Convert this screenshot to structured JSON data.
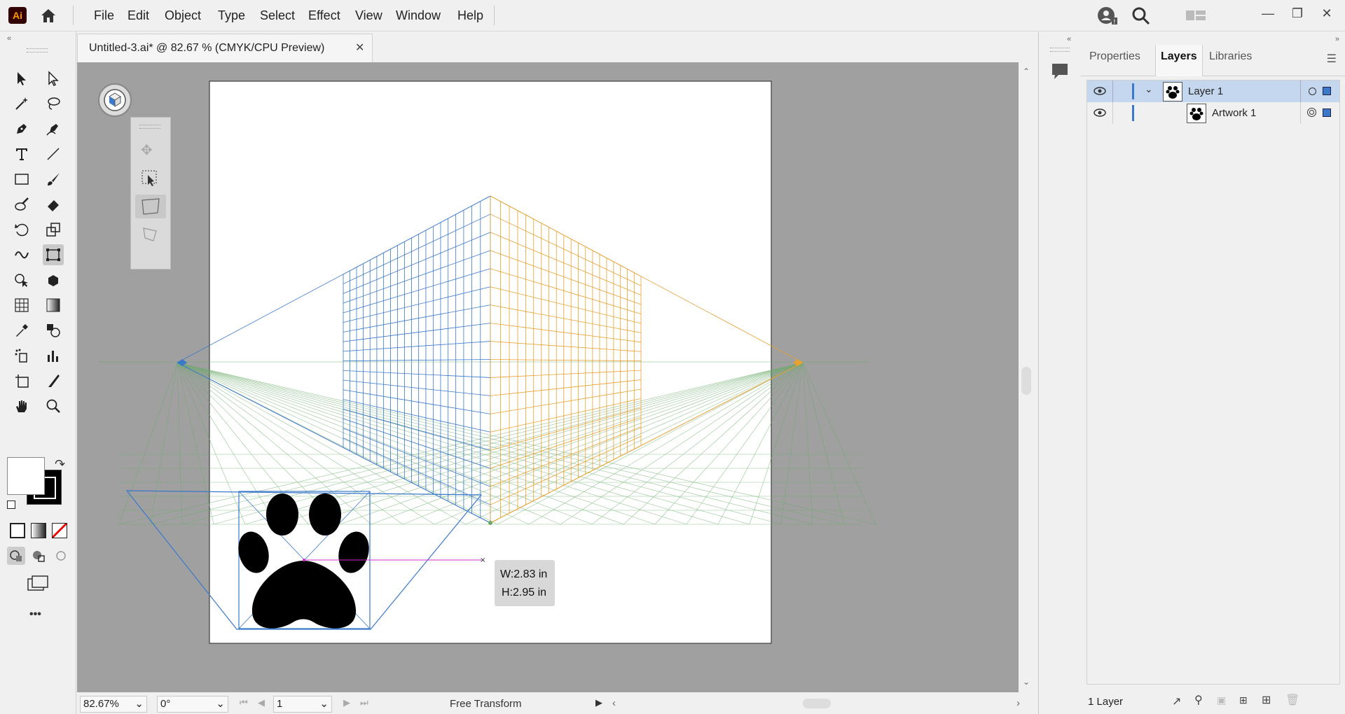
{
  "app": {
    "logo": "Ai",
    "home_icon": "home-icon"
  },
  "menu": {
    "items": [
      "File",
      "Edit",
      "Object",
      "Type",
      "Select",
      "Effect",
      "View",
      "Window",
      "Help"
    ]
  },
  "document": {
    "tab_title": "Untitled-3.ai* @ 82.67 % (CMYK/CPU Preview)",
    "close": "✕"
  },
  "canvas": {
    "size_tooltip": {
      "w": "W:2.83 in",
      "h": "H:2.95 in"
    },
    "artboard_color": "#ffffff",
    "grid_left_color": "#3a78c9",
    "grid_right_color": "#e8a030",
    "ground_grid_color": "#5aa05a"
  },
  "status": {
    "zoom": "82.67%",
    "rotation": "0°",
    "page": "1",
    "tool": "Free Transform"
  },
  "right_panel": {
    "tabs": [
      "Properties",
      "Layers",
      "Libraries"
    ],
    "active_tab": "Layers",
    "layers": [
      {
        "name": "Layer 1",
        "expanded": true,
        "selected": true
      },
      {
        "name": "Artwork 1",
        "expanded": false,
        "selected": false
      }
    ],
    "footer_count": "1 Layer"
  },
  "toolbar": {
    "tools": [
      "selection-tool",
      "direct-selection-tool",
      "magic-wand-tool",
      "lasso-tool",
      "pen-tool",
      "curvature-tool",
      "type-tool",
      "line-segment-tool",
      "rectangle-tool",
      "paintbrush-tool",
      "shaper-tool",
      "eraser-tool",
      "rotate-tool",
      "scale-tool",
      "width-tool",
      "free-transform-tool",
      "shape-builder-tool",
      "perspective-grid-tool",
      "mesh-tool",
      "gradient-tool",
      "eyedropper-tool",
      "blend-tool",
      "symbol-sprayer-tool",
      "column-graph-tool",
      "artboard-tool",
      "slice-tool",
      "hand-tool",
      "zoom-tool"
    ],
    "more": "•••"
  },
  "colors": {
    "fill": "#ffffff",
    "stroke": "#000000"
  }
}
